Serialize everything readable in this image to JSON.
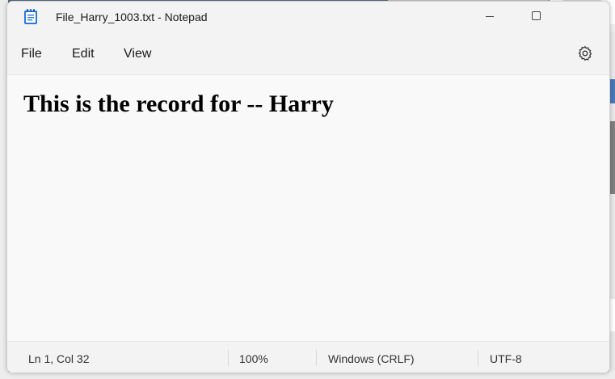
{
  "window": {
    "title": "File_Harry_1003.txt - Notepad",
    "app_icon": "notepad-icon"
  },
  "menu": {
    "items": [
      {
        "label": "File"
      },
      {
        "label": "Edit"
      },
      {
        "label": "View"
      }
    ],
    "settings_icon": "gear-icon"
  },
  "editor": {
    "content": "This is the record for -- Harry"
  },
  "status": {
    "position": "Ln 1, Col 32",
    "zoom": "100%",
    "line_ending": "Windows (CRLF)",
    "encoding": "UTF-8"
  },
  "colors": {
    "accent": "#2b7bd6",
    "window_bg": "#f9f9f9",
    "chrome_bg": "#f3f3f3"
  }
}
